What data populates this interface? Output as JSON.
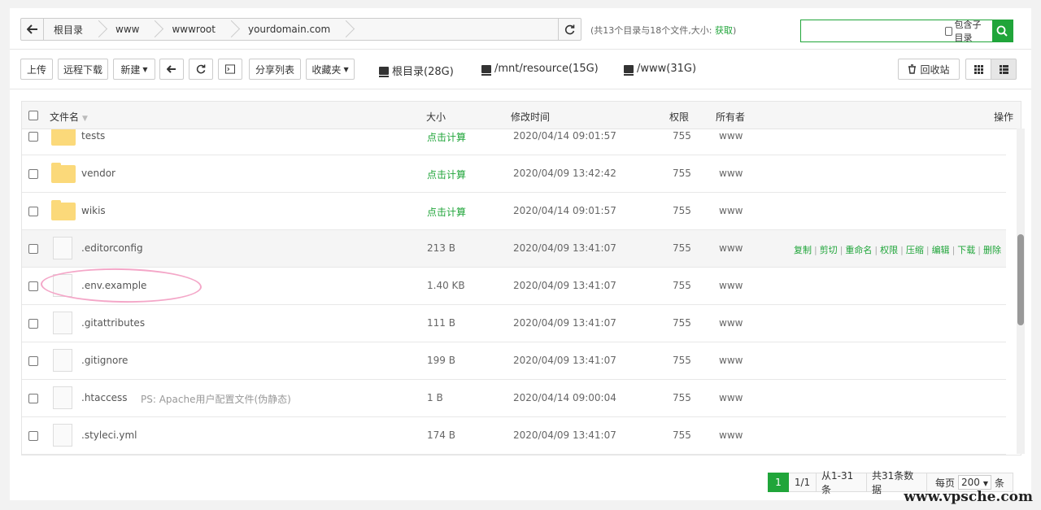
{
  "address_bar": {
    "crumbs": [
      "根目录",
      "www",
      "wwwroot",
      "yourdomain.com"
    ],
    "summary_prefix": "(共13个目录与18个文件,大小:",
    "summary_link": "获取",
    "summary_suffix": ")"
  },
  "search": {
    "placeholder": "",
    "subdir_label": "包含子目录"
  },
  "toolbar": {
    "upload": "上传",
    "remote_download": "远程下载",
    "new": "新建",
    "share_list": "分享列表",
    "favorites": "收藏夹",
    "disks": [
      "根目录(28G)",
      "/mnt/resource(15G)",
      "/www(31G)"
    ],
    "recycle": "回收站"
  },
  "table": {
    "headers": {
      "name": "文件名",
      "size": "大小",
      "mtime": "修改时间",
      "perm": "权限",
      "owner": "所有者",
      "ops": "操作"
    },
    "rows": [
      {
        "type": "folder",
        "name": "tests",
        "size": "点击计算",
        "mtime": "2020/04/14 09:01:57",
        "perm": "755",
        "owner": "www"
      },
      {
        "type": "folder",
        "name": "vendor",
        "size": "点击计算",
        "mtime": "2020/04/09 13:42:42",
        "perm": "755",
        "owner": "www"
      },
      {
        "type": "folder",
        "name": "wikis",
        "size": "点击计算",
        "mtime": "2020/04/14 09:01:57",
        "perm": "755",
        "owner": "www"
      },
      {
        "type": "file",
        "name": ".editorconfig",
        "size": "213 B",
        "mtime": "2020/04/09 13:41:07",
        "perm": "755",
        "owner": "www"
      },
      {
        "type": "file",
        "name": ".env.example",
        "size": "1.40 KB",
        "mtime": "2020/04/09 13:41:07",
        "perm": "755",
        "owner": "www"
      },
      {
        "type": "file",
        "name": ".gitattributes",
        "size": "111 B",
        "mtime": "2020/04/09 13:41:07",
        "perm": "755",
        "owner": "www"
      },
      {
        "type": "file",
        "name": ".gitignore",
        "size": "199 B",
        "mtime": "2020/04/09 13:41:07",
        "perm": "755",
        "owner": "www"
      },
      {
        "type": "file",
        "name": ".htaccess",
        "note": "PS: Apache用户配置文件(伪静态)",
        "size": "1 B",
        "mtime": "2020/04/14 09:00:04",
        "perm": "755",
        "owner": "www"
      },
      {
        "type": "file",
        "name": ".styleci.yml",
        "size": "174 B",
        "mtime": "2020/04/09 13:41:07",
        "perm": "755",
        "owner": "www"
      }
    ],
    "row_ops": [
      "复制",
      "剪切",
      "重命名",
      "权限",
      "压缩",
      "编辑",
      "下载",
      "删除"
    ]
  },
  "pager": {
    "current": "1",
    "pages": "1/1",
    "range": "从1-31条",
    "total": "共31条数据",
    "per_page_label": "每页",
    "per_page_value": "200",
    "unit": "条"
  },
  "watermark": "www.vpsche.com",
  "colors": {
    "accent": "#20a53a",
    "folder": "#fbd97a",
    "annotation": "#f4a7c8"
  }
}
